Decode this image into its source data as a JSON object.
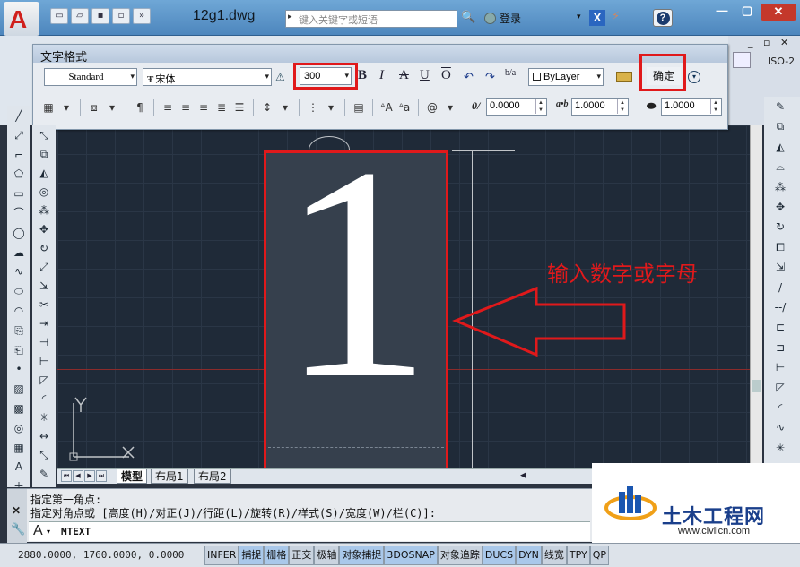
{
  "window": {
    "title": "12g1.dwg",
    "search_placeholder": "键入关键字或短语",
    "login_label": "登录",
    "help_label": "?"
  },
  "ribbon_right": {
    "dim_style": "ISO-2"
  },
  "text_format": {
    "title": "文字格式",
    "style": "Standard",
    "font": "宋体",
    "height": "300",
    "color": "ByLayer",
    "ok_label": "确定",
    "oblique": "0.0000",
    "tracking": "1.0000",
    "width_factor": "1.0000",
    "colors": {
      "highlight": "#e0191b"
    }
  },
  "canvas": {
    "text_content": "1",
    "annotation": "输入数字或字母",
    "ucs_y": "Y"
  },
  "tabs": {
    "model": "模型",
    "layout1": "布局1",
    "layout2": "布局2"
  },
  "command": {
    "line1": "指定第一角点:",
    "line2": "指定对角点或 [高度(H)/对正(J)/行距(L)/旋转(R)/样式(S)/宽度(W)/栏(C)]:",
    "current": "MTEXT"
  },
  "status": {
    "coords": "2880.0000, 1760.0000, 0.0000",
    "toggles": [
      "INFER",
      "捕捉",
      "栅格",
      "正交",
      "极轴",
      "对象捕捉",
      "3DOSNAP",
      "对象追踪",
      "DUCS",
      "DYN",
      "线宽",
      "TPY",
      "QP"
    ]
  },
  "watermark": {
    "title": "土木工程网",
    "url": "www.civilcn.com"
  }
}
